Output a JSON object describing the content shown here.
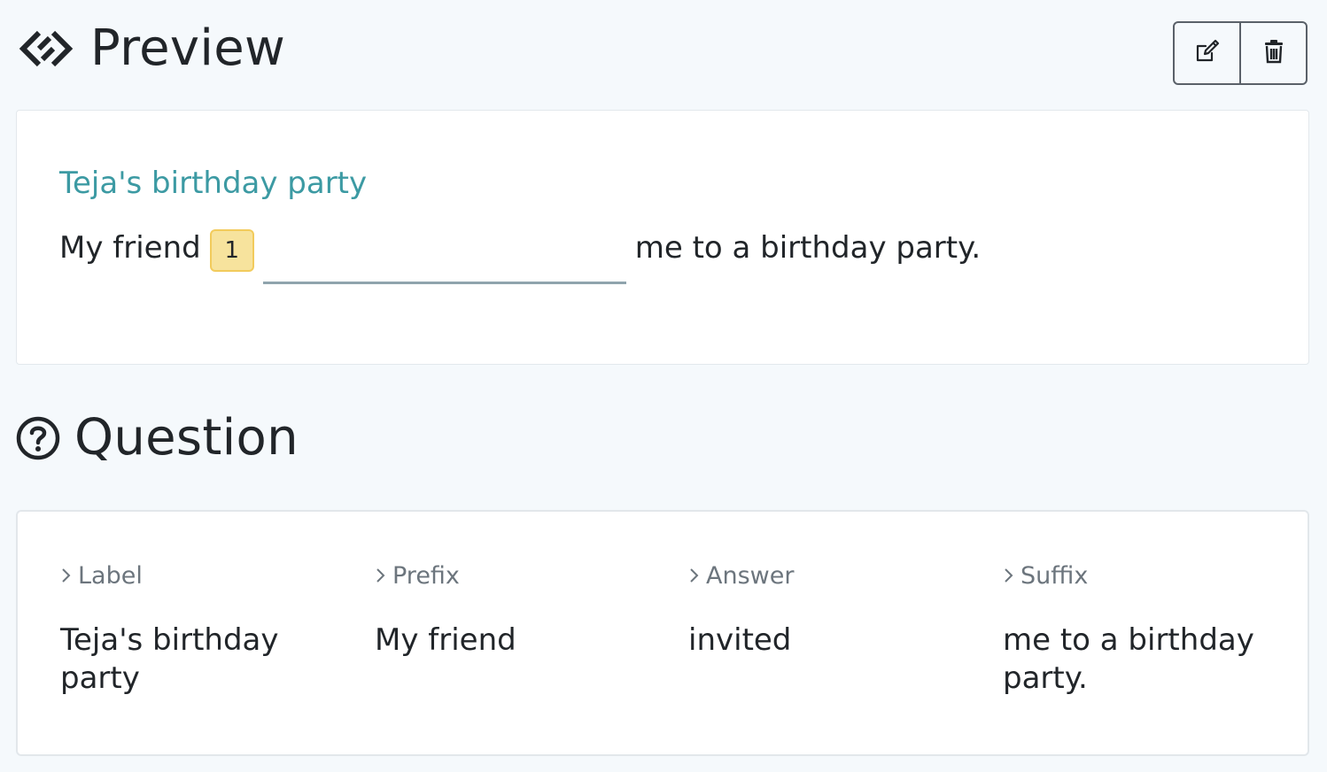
{
  "preview": {
    "title": "Preview",
    "icon": "code-diamond-icon",
    "actions": [
      {
        "name": "edit",
        "icon": "edit-icon"
      },
      {
        "name": "delete",
        "icon": "trash-icon"
      }
    ],
    "card": {
      "label": "Teja's birthday party",
      "prefix": "My friend",
      "badge": "1",
      "answer_value": "",
      "suffix": "me to a birthday party."
    }
  },
  "question": {
    "title": "Question",
    "icon": "question-circle-icon",
    "columns": [
      {
        "header": "Label",
        "value": "Teja's birthday party"
      },
      {
        "header": "Prefix",
        "value": "My friend"
      },
      {
        "header": "Answer",
        "value": "invited"
      },
      {
        "header": "Suffix",
        "value": "me to a birthday party."
      }
    ]
  },
  "colors": {
    "background": "#f5f9fc",
    "accent": "#3c9aa3",
    "badge_bg": "#f7e39d",
    "badge_border": "#f2cb5c"
  }
}
